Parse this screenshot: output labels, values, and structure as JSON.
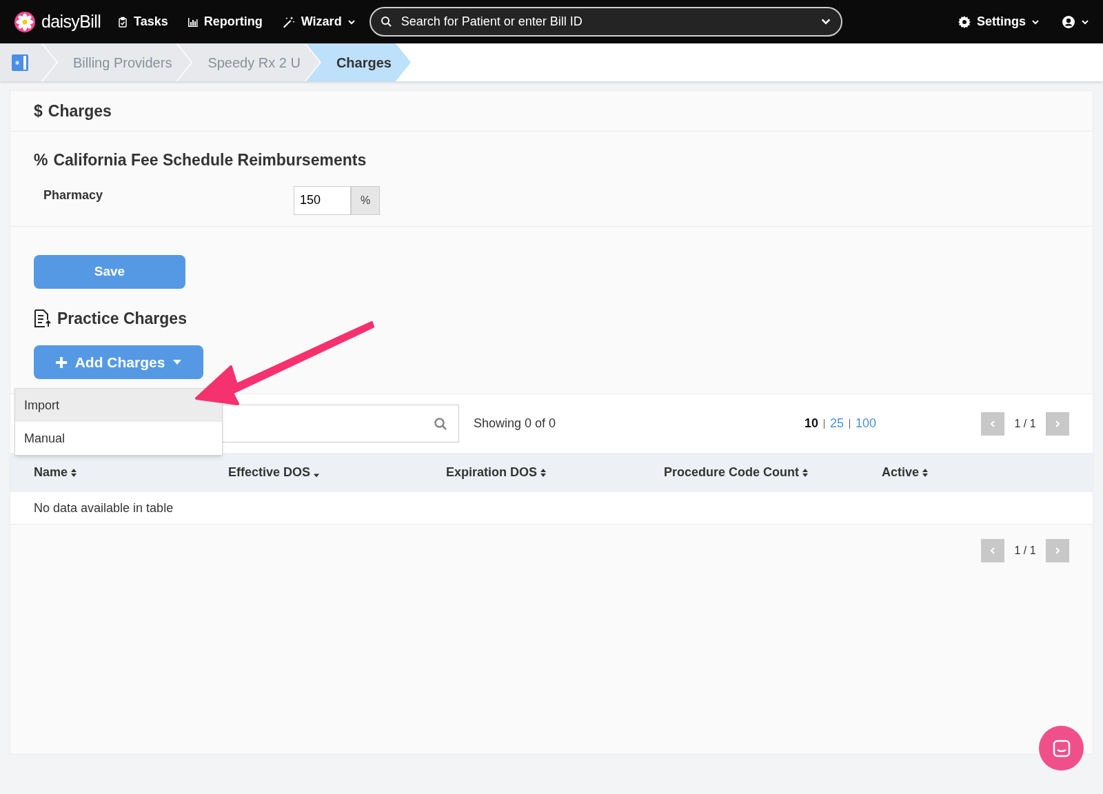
{
  "nav": {
    "brand": "daisyBill",
    "items": [
      {
        "kind": "tasks",
        "label": "Tasks",
        "caret": false
      },
      {
        "kind": "reporting",
        "label": "Reporting",
        "caret": false
      },
      {
        "kind": "wizard",
        "label": "Wizard",
        "caret": true
      }
    ],
    "search": {
      "placeholder": "Search for Patient or enter Bill ID"
    },
    "settings": {
      "label": "Settings"
    }
  },
  "breadcrumb": [
    {
      "kind": "icon",
      "selected": false
    },
    {
      "kind": "text",
      "label": "Billing Providers",
      "selected": false
    },
    {
      "kind": "text",
      "label": "Speedy Rx 2 U",
      "selected": false
    },
    {
      "kind": "text",
      "label": "Charges",
      "selected": true
    }
  ],
  "page": {
    "title_icon": "$",
    "title": "Charges"
  },
  "fee_schedule": {
    "icon": "%",
    "title": "California Fee Schedule Reimbursements",
    "rows": [
      {
        "label": "Pharmacy",
        "value": "150",
        "suffix": "%"
      }
    ]
  },
  "save_button": "Save",
  "practice_charges": {
    "title": "Practice Charges",
    "add_button": "Add Charges",
    "menu": [
      {
        "label": "Import",
        "selected": true
      },
      {
        "label": "Manual",
        "selected": false
      }
    ],
    "showing": "Showing 0 of 0",
    "page_sizes": [
      {
        "label": "10",
        "selected": true
      },
      {
        "label": "25",
        "selected": false
      },
      {
        "label": "100",
        "selected": false
      }
    ],
    "pagination": "1 / 1",
    "columns": [
      {
        "label": "Name",
        "sorted": false
      },
      {
        "label": "Effective DOS",
        "sorted": true
      },
      {
        "label": "Expiration DOS",
        "sorted": false
      },
      {
        "label": "Procedure Code Count",
        "sorted": false
      },
      {
        "label": "Active",
        "sorted": false
      }
    ],
    "empty": "No data available in table",
    "pagination_bottom": "1 / 1"
  }
}
